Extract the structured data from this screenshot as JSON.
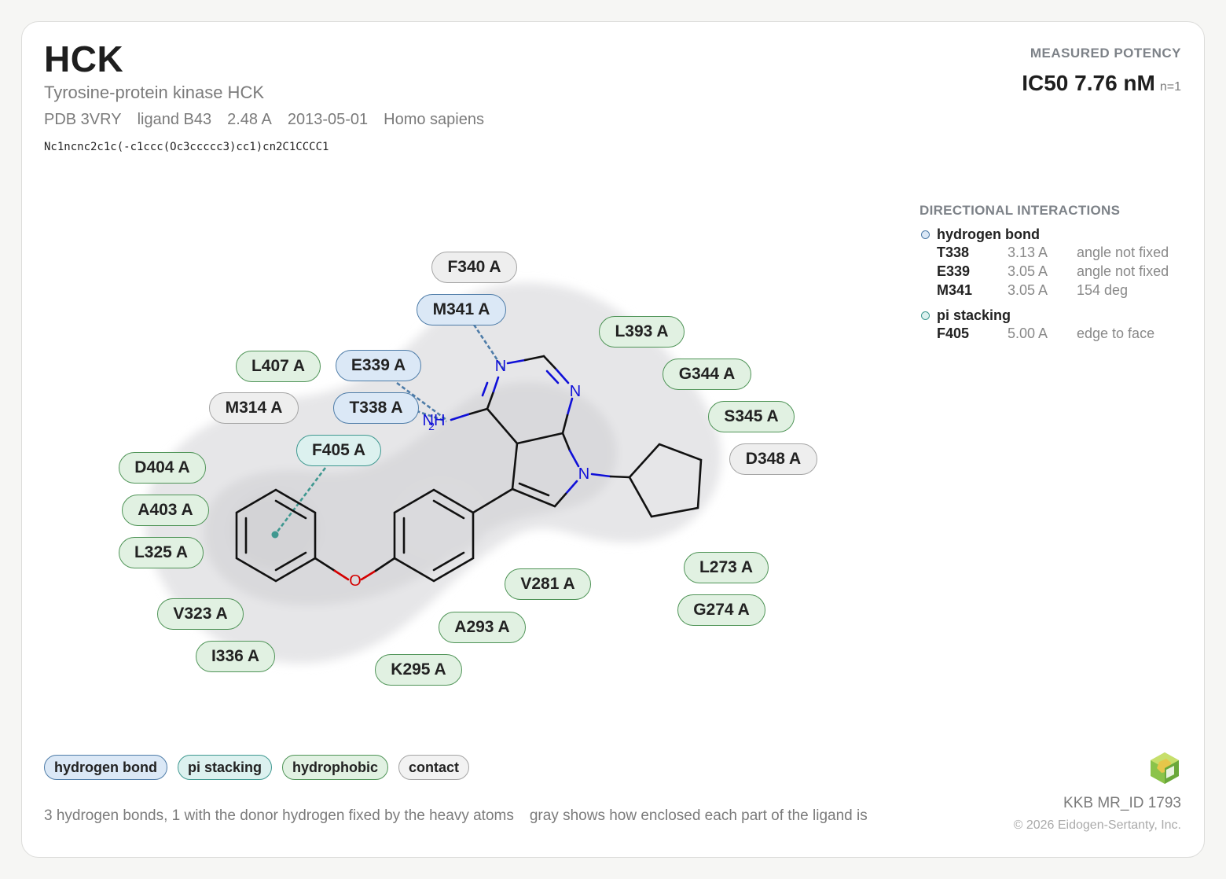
{
  "header": {
    "target": "HCK",
    "protein_name": "Tyrosine-protein kinase HCK",
    "meta": [
      "PDB 3VRY",
      "ligand B43",
      "2.48 A",
      "2013-05-01",
      "Homo sapiens"
    ],
    "smiles": "Nc1ncnc2c1c(-c1ccc(Oc3ccccc3)cc1)cn2C1CCCC1"
  },
  "potency": {
    "heading": "MEASURED POTENCY",
    "value": "IC50 7.76 nM",
    "n": "n=1"
  },
  "interactions": {
    "heading": "DIRECTIONAL INTERACTIONS",
    "groups": [
      {
        "type": "hydrogen bond",
        "color": "#4e7ca8",
        "rows": [
          {
            "residue": "T338",
            "distance": "3.13 A",
            "geometry": "angle not fixed"
          },
          {
            "residue": "E339",
            "distance": "3.05 A",
            "geometry": "angle not fixed"
          },
          {
            "residue": "M341",
            "distance": "3.05 A",
            "geometry": "154 deg"
          }
        ]
      },
      {
        "type": "pi stacking",
        "color": "#3f9890",
        "rows": [
          {
            "residue": "F405",
            "distance": "5.00 A",
            "geometry": "edge to face"
          }
        ]
      }
    ]
  },
  "diagram": {
    "atom_labels": {
      "n1": "N",
      "n3": "N",
      "n7": "N",
      "nh2": "NH",
      "h_sub": "2",
      "o": "O"
    },
    "residues": [
      {
        "label": "F340 A",
        "kind": "contact"
      },
      {
        "label": "M341 A",
        "kind": "hydrogen bond"
      },
      {
        "label": "L393 A",
        "kind": "hydrophobic"
      },
      {
        "label": "L407 A",
        "kind": "hydrophobic"
      },
      {
        "label": "E339 A",
        "kind": "hydrogen bond"
      },
      {
        "label": "G344 A",
        "kind": "hydrophobic"
      },
      {
        "label": "M314 A",
        "kind": "contact"
      },
      {
        "label": "T338 A",
        "kind": "hydrogen bond"
      },
      {
        "label": "S345 A",
        "kind": "hydrophobic"
      },
      {
        "label": "F405 A",
        "kind": "pi stacking"
      },
      {
        "label": "D348 A",
        "kind": "contact"
      },
      {
        "label": "D404 A",
        "kind": "hydrophobic"
      },
      {
        "label": "A403 A",
        "kind": "hydrophobic"
      },
      {
        "label": "L325 A",
        "kind": "hydrophobic"
      },
      {
        "label": "L273 A",
        "kind": "hydrophobic"
      },
      {
        "label": "V281 A",
        "kind": "hydrophobic"
      },
      {
        "label": "V323 A",
        "kind": "hydrophobic"
      },
      {
        "label": "G274 A",
        "kind": "hydrophobic"
      },
      {
        "label": "A293 A",
        "kind": "hydrophobic"
      },
      {
        "label": "I336 A",
        "kind": "hydrophobic"
      },
      {
        "label": "K295 A",
        "kind": "hydrophobic"
      }
    ]
  },
  "legend": {
    "chips": [
      "hydrogen bond",
      "pi stacking",
      "hydrophobic",
      "contact"
    ]
  },
  "footer": {
    "notes": [
      "3 hydrogen bonds, 1 with the donor hydrogen fixed by the heavy atoms",
      "gray shows how enclosed each part of the ligand is"
    ],
    "id": "KKB MR_ID 1793",
    "copyright": "© 2026 Eidogen-Sertanty, Inc."
  }
}
